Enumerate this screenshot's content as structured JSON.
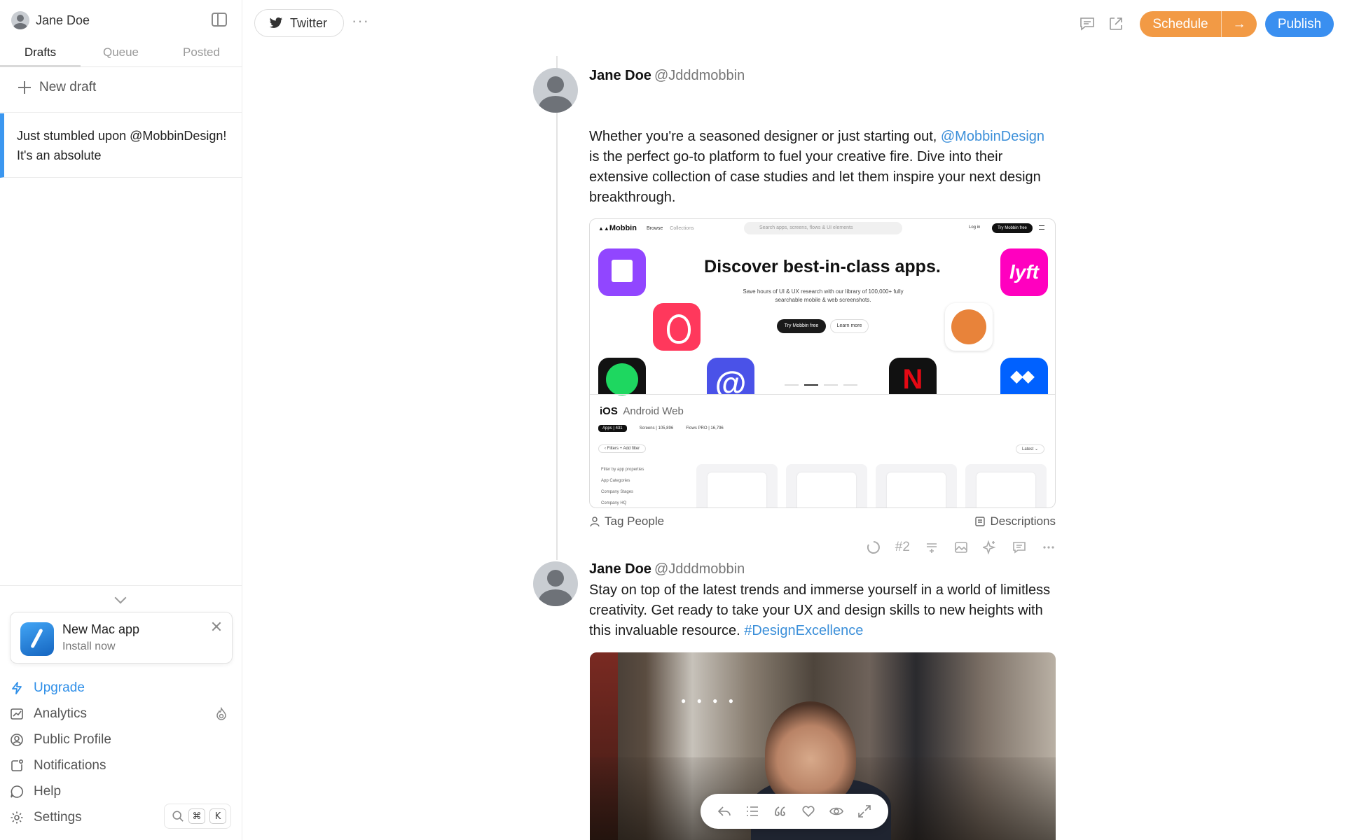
{
  "sidebar": {
    "user_name": "Jane Doe",
    "tabs": [
      "Drafts",
      "Queue",
      "Posted"
    ],
    "new_draft_label": "New draft",
    "draft_preview": "Just stumbled upon @MobbinDesign! It's an absolute",
    "mac_app": {
      "title": "New Mac app",
      "subtitle": "Install now"
    },
    "nav": [
      {
        "label": "Upgrade",
        "icon": "bolt-icon"
      },
      {
        "label": "Analytics",
        "icon": "chart-icon"
      },
      {
        "label": "Public Profile",
        "icon": "profile-icon"
      },
      {
        "label": "Notifications",
        "icon": "bell-icon"
      },
      {
        "label": "Help",
        "icon": "help-bubble-icon"
      },
      {
        "label": "Settings",
        "icon": "gear-icon"
      }
    ],
    "shortcut": {
      "cmd": "⌘",
      "key": "K"
    }
  },
  "topbar": {
    "platform_label": "Twitter",
    "more_label": "···",
    "schedule_label": "Schedule",
    "schedule_arrow": "→",
    "publish_label": "Publish"
  },
  "tweets": [
    {
      "author": "Jane Doe",
      "handle": "@Jdddmobbin",
      "text_before": "Whether you're a seasoned designer or just starting out, ",
      "mention": "@MobbinDesign",
      "text_after": " is the perfect go-to platform to fuel your creative fire. Dive into their extensive collection of case studies and let them inspire your next design breakthrough.",
      "tag_people_label": "Tag People",
      "descriptions_label": "Descriptions",
      "counter": "#2"
    },
    {
      "author": "Jane Doe",
      "handle": "@Jdddmobbin",
      "text": "Stay on top of the latest trends and immerse yourself in a world of limitless creativity. Get ready to take your UX and design skills to new heights with this invaluable resource. ",
      "hashtag": "#DesignExcellence"
    }
  ],
  "embed": {
    "logo": "Mobbin",
    "nav_links": [
      "Browse",
      "Collections"
    ],
    "search_placeholder": "Search apps, screens, flows & UI elements",
    "login": "Log in",
    "try_free": "Try Mobbin free",
    "hero_title": "Discover best-in-class apps.",
    "hero_sub": "Save hours of UI & UX research with our library of 100,000+ fully searchable mobile & web screenshots.",
    "btn_try": "Try Mobbin free",
    "btn_learn": "Learn more",
    "platform_ios": "iOS",
    "platform_rest": "Android  Web",
    "seg_apps": "Apps | 431",
    "seg_screens": "Screens | 105,896",
    "seg_flows": "Flows PRO | 16,796",
    "filters": "‹ Filters   + Add filter",
    "latest": "Latest ⌄",
    "side_filters": "Filter by app properties\nApp Categories\nCompany Stages\nCompany HQ",
    "tile_lyft": "lyft",
    "tile_at": "@",
    "tile_netflix": "N"
  },
  "colors": {
    "accent_blue": "#3a8ff0",
    "schedule_orange": "#f29a45",
    "link_blue": "#3b8fd9",
    "draft_indicator": "#3b97f0"
  }
}
